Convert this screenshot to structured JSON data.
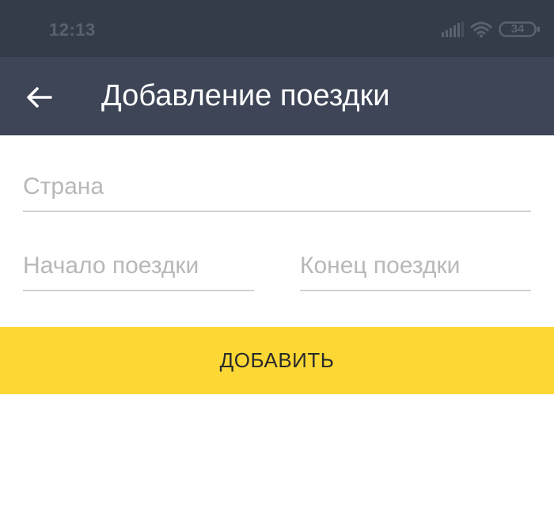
{
  "status_bar": {
    "time": "12:13",
    "battery": "34",
    "icons": [
      "signal-icon",
      "wifi-icon",
      "battery-icon"
    ]
  },
  "app_bar": {
    "back_icon": "arrow-left-icon",
    "title": "Добавление поездки"
  },
  "form": {
    "country": {
      "value": "",
      "placeholder": "Страна"
    },
    "trip_start": {
      "value": "",
      "placeholder": "Начало поездки"
    },
    "trip_end": {
      "value": "",
      "placeholder": "Конец поездки"
    }
  },
  "actions": {
    "add_label": "ДОБАВИТЬ"
  },
  "colors": {
    "status_bar": "#343b49",
    "app_bar": "#3d4556",
    "accent": "#fdd835",
    "divider": "#d2d2d2",
    "placeholder": "#b8b8b8"
  }
}
